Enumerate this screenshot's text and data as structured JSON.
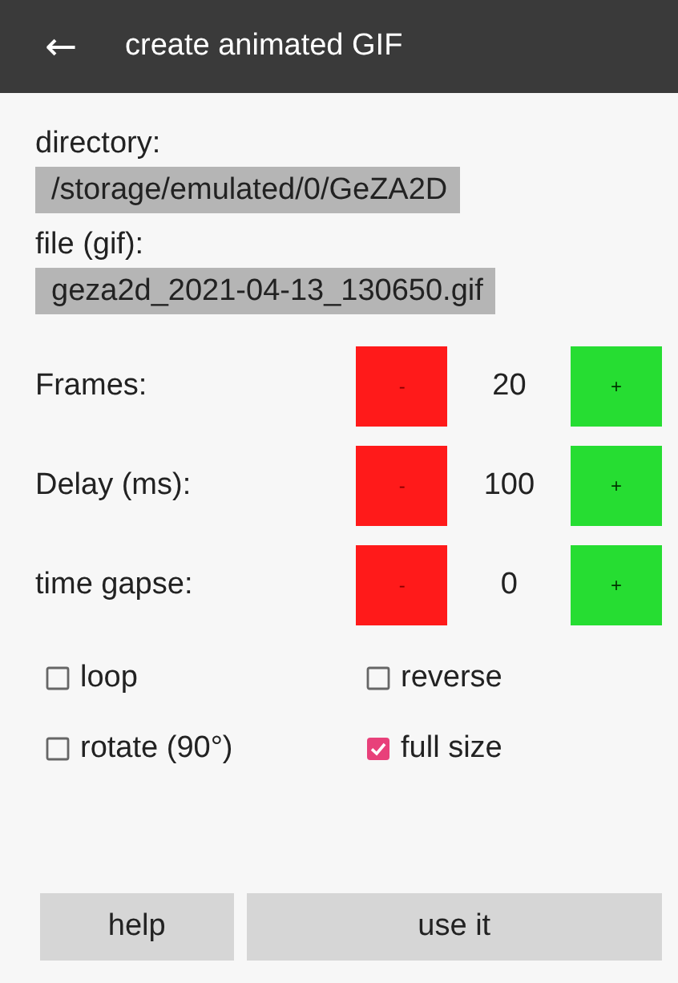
{
  "app_bar": {
    "back_icon": "←",
    "title": "create animated GIF"
  },
  "fields": [
    {
      "label": "directory:",
      "value": "/storage/emulated/0/GeZA2D"
    },
    {
      "label": "file (gif):",
      "value": "geza2d_2021-04-13_130650.gif"
    }
  ],
  "steppers": [
    {
      "label": "Frames:",
      "minus": "-",
      "value": "20",
      "plus": "+"
    },
    {
      "label": "Delay (ms):",
      "minus": "-",
      "value": "100",
      "plus": "+"
    },
    {
      "label": "time gapse:",
      "minus": "-",
      "value": "0",
      "plus": "+"
    }
  ],
  "options": [
    {
      "label": "loop",
      "checked": false
    },
    {
      "label": "reverse",
      "checked": false
    },
    {
      "label": "rotate (90°)",
      "checked": false
    },
    {
      "label": "full size",
      "checked": true
    }
  ],
  "buttons": [
    "help",
    "use it"
  ]
}
